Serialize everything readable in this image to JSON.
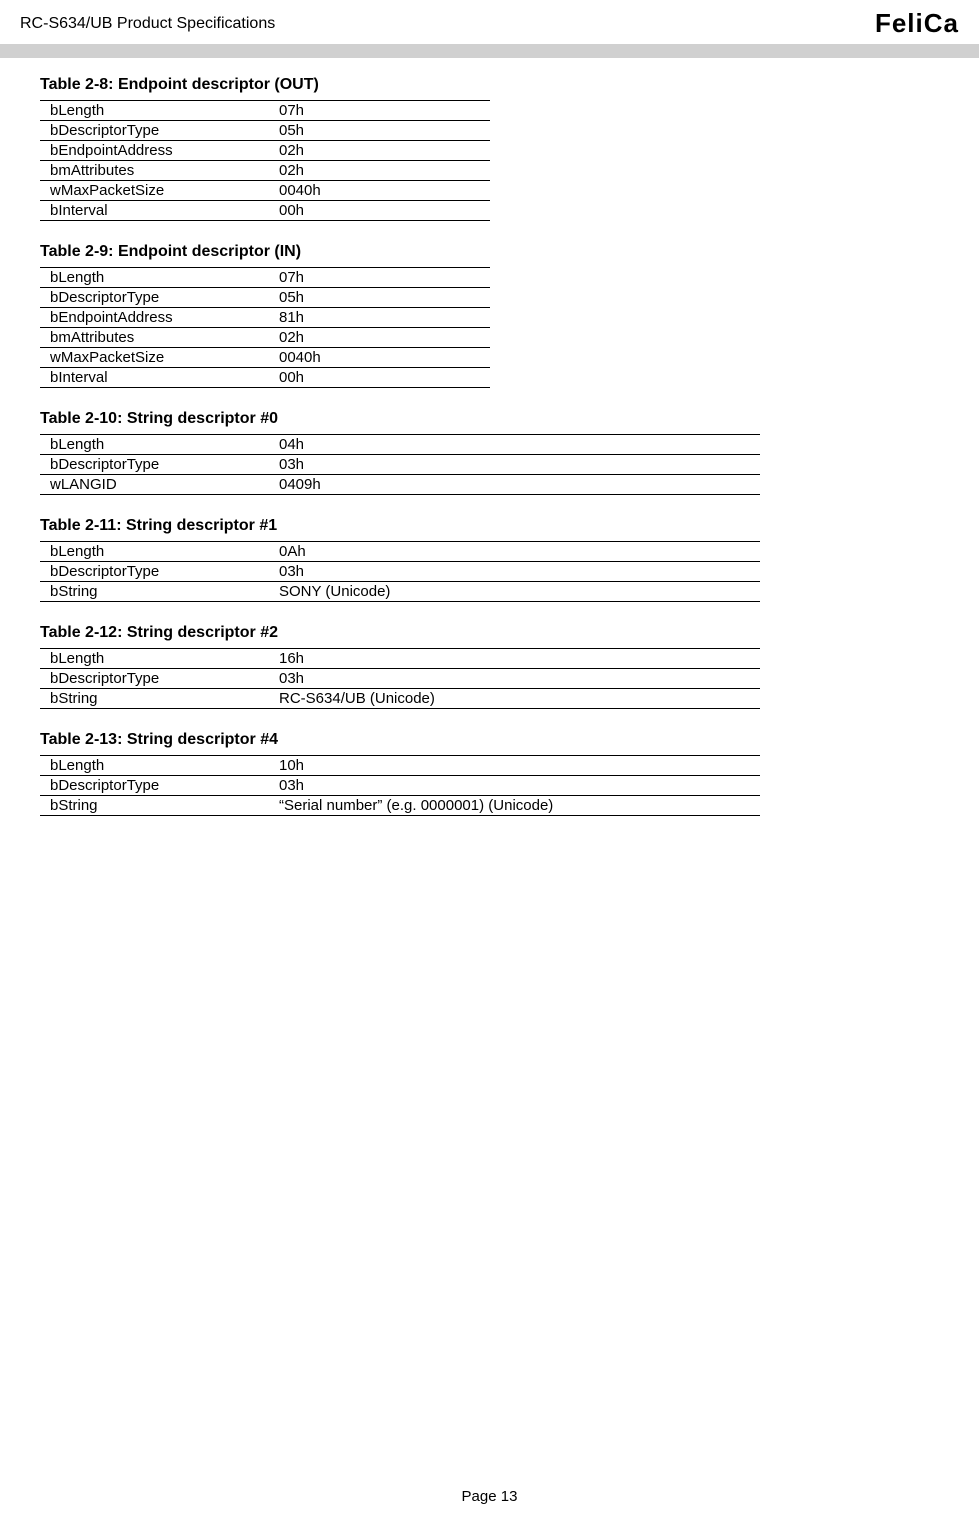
{
  "header": {
    "product": "RC-S634/UB Product Specifications",
    "logo": "FeliCa"
  },
  "tables": [
    {
      "caption": "Table 2-8: Endpoint descriptor (OUT)",
      "width": "narrow",
      "rows": [
        {
          "k": "bLength",
          "v": "07h"
        },
        {
          "k": "bDescriptorType",
          "v": "05h"
        },
        {
          "k": "bEndpointAddress",
          "v": "02h"
        },
        {
          "k": "bmAttributes",
          "v": "02h"
        },
        {
          "k": "wMaxPacketSize",
          "v": "0040h"
        },
        {
          "k": "bInterval",
          "v": "00h"
        }
      ]
    },
    {
      "caption": "Table 2-9: Endpoint descriptor (IN)",
      "width": "narrow",
      "rows": [
        {
          "k": "bLength",
          "v": "07h"
        },
        {
          "k": "bDescriptorType",
          "v": "05h"
        },
        {
          "k": "bEndpointAddress",
          "v": "81h"
        },
        {
          "k": "bmAttributes",
          "v": "02h"
        },
        {
          "k": "wMaxPacketSize",
          "v": "0040h"
        },
        {
          "k": "bInterval",
          "v": "00h"
        }
      ]
    },
    {
      "caption": "Table 2-10: String descriptor #0",
      "width": "wide",
      "rows": [
        {
          "k": "bLength",
          "v": "04h"
        },
        {
          "k": "bDescriptorType",
          "v": "03h"
        },
        {
          "k": "wLANGID",
          "v": "0409h"
        }
      ]
    },
    {
      "caption": "Table 2-11: String descriptor #1",
      "width": "wide",
      "rows": [
        {
          "k": "bLength",
          "v": "0Ah"
        },
        {
          "k": "bDescriptorType",
          "v": "03h"
        },
        {
          "k": "bString",
          "v": "SONY (Unicode)"
        }
      ]
    },
    {
      "caption": "Table 2-12: String descriptor #2",
      "width": "wide",
      "rows": [
        {
          "k": "bLength",
          "v": "16h"
        },
        {
          "k": "bDescriptorType",
          "v": "03h"
        },
        {
          "k": "bString",
          "v": "RC-S634/UB (Unicode)"
        }
      ]
    },
    {
      "caption": "Table 2-13: String descriptor #4",
      "width": "wide",
      "rows": [
        {
          "k": "bLength",
          "v": "10h"
        },
        {
          "k": "bDescriptorType",
          "v": "03h"
        },
        {
          "k": "bString",
          "v": "“Serial number” (e.g. 0000001) (Unicode)"
        }
      ]
    }
  ],
  "footer": {
    "page": "Page 13"
  }
}
